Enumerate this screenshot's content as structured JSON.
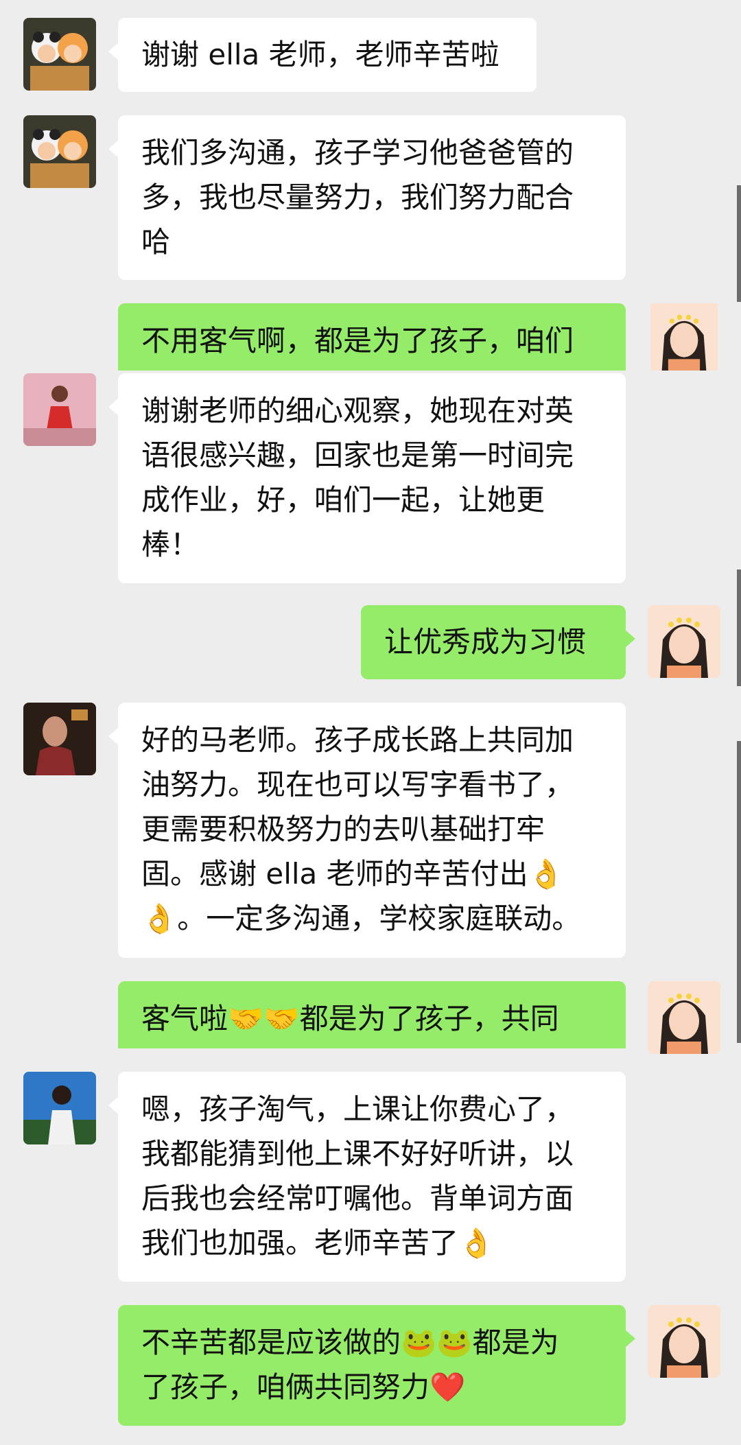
{
  "messages": [
    {
      "side": "left",
      "avatar": "avatar-panda-dolls",
      "text": "谢谢 ella 老师，老师辛苦啦"
    },
    {
      "side": "left",
      "avatar": "avatar-panda-dolls",
      "text": "我们多沟通，孩子学习他爸爸管的\n多，我也尽量努力，我们努力配合\n哈"
    },
    {
      "side": "right",
      "avatar": "avatar-teacher",
      "text": "不用客气啊，都是为了孩子，咱们"
    },
    {
      "side": "left",
      "avatar": "avatar-girl-red",
      "text": "谢谢老师的细心观察，她现在对英\n语很感兴趣，回家也是第一时间完\n成作业，好，咱们一起，让她更\n棒！"
    },
    {
      "side": "right",
      "avatar": "avatar-teacher",
      "text": "让优秀成为习惯"
    },
    {
      "side": "left",
      "avatar": "avatar-man-dark",
      "text": "好的马老师。孩子成长路上共同加\n油努力。现在也可以写字看书了，\n更需要积极努力的去叭基础打牢\n固。感谢 ella 老师的辛苦付出👌\n👌。一定多沟通，学校家庭联动。"
    },
    {
      "side": "right",
      "avatar": "avatar-teacher",
      "text": "客气啦🤝🤝都是为了孩子，共同"
    },
    {
      "side": "left",
      "avatar": "avatar-woman-sky",
      "text": "嗯，孩子淘气，上课让你费心了，\n我都能猜到他上课不好好听讲，以\n后我也会经常叮嘱他。背单词方面\n我们也加强。老师辛苦了👌"
    },
    {
      "side": "right",
      "avatar": "avatar-teacher",
      "text": "不辛苦都是应该做的🐸🐸都是为\n了孩子，咱俩共同努力❤️"
    }
  ]
}
